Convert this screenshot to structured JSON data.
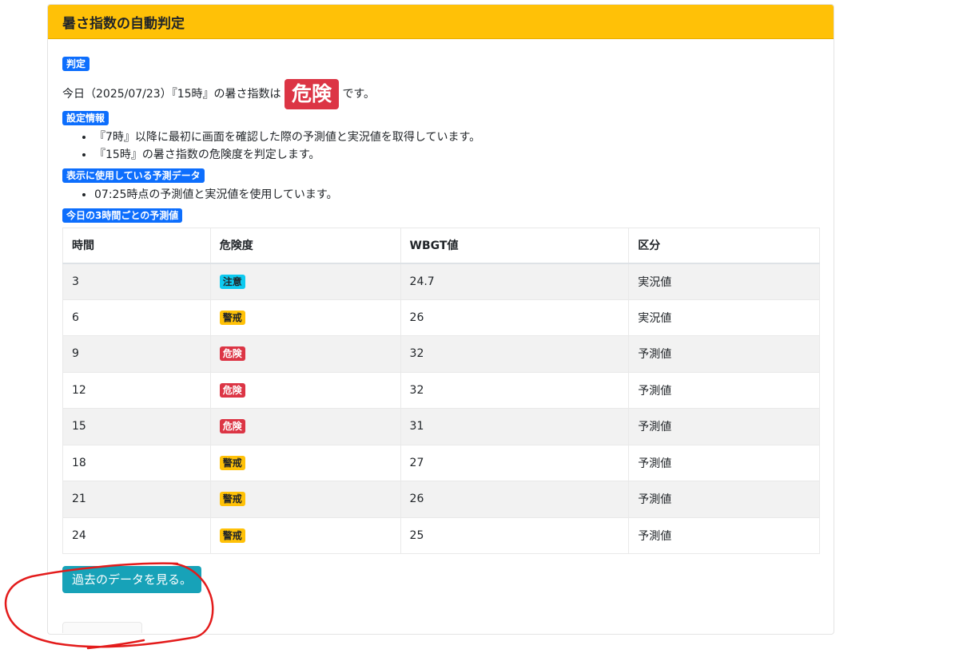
{
  "header": {
    "title": "暑さ指数の自動判定"
  },
  "judgement": {
    "label": "判定",
    "prefix": "今日（2025/07/23）『15時』の暑さ指数は",
    "level": "危険",
    "suffix": "です。"
  },
  "settings": {
    "label": "設定情報",
    "items": [
      "『7時』以降に最初に画面を確認した際の予測値と実況値を取得しています。",
      "『15時』の暑さ指数の危険度を判定します。"
    ]
  },
  "forecast_data": {
    "label": "表示に使用している予測データ",
    "items": [
      "07:25時点の予測値と実況値を使用しています。"
    ]
  },
  "table": {
    "label": "今日の3時間ごとの予測値",
    "headers": [
      "時間",
      "危険度",
      "WBGT値",
      "区分"
    ],
    "rows": [
      {
        "time": "3",
        "level": "注意",
        "level_color": "#0dcaf0",
        "wbgt": "24.7",
        "kind": "実況値"
      },
      {
        "time": "6",
        "level": "警戒",
        "level_color": "#ffc107",
        "wbgt": "26",
        "kind": "実況値"
      },
      {
        "time": "9",
        "level": "危険",
        "level_color": "#dc3545",
        "wbgt": "32",
        "kind": "予測値"
      },
      {
        "time": "12",
        "level": "危険",
        "level_color": "#dc3545",
        "wbgt": "32",
        "kind": "予測値"
      },
      {
        "time": "15",
        "level": "危険",
        "level_color": "#dc3545",
        "wbgt": "31",
        "kind": "予測値"
      },
      {
        "time": "18",
        "level": "警戒",
        "level_color": "#ffc107",
        "wbgt": "27",
        "kind": "予測値"
      },
      {
        "time": "21",
        "level": "警戒",
        "level_color": "#ffc107",
        "wbgt": "26",
        "kind": "予測値"
      },
      {
        "time": "24",
        "level": "警戒",
        "level_color": "#ffc107",
        "wbgt": "25",
        "kind": "予測値"
      }
    ]
  },
  "actions": {
    "past_data_button": "過去のデータを見る。"
  },
  "colors": {
    "header": "#ffc107",
    "primary": "#0d6efd",
    "danger": "#dc3545",
    "warning": "#ffc107",
    "info": "#0dcaf0",
    "teal_button": "#17a2b8",
    "annotation": "#e31b1b"
  }
}
